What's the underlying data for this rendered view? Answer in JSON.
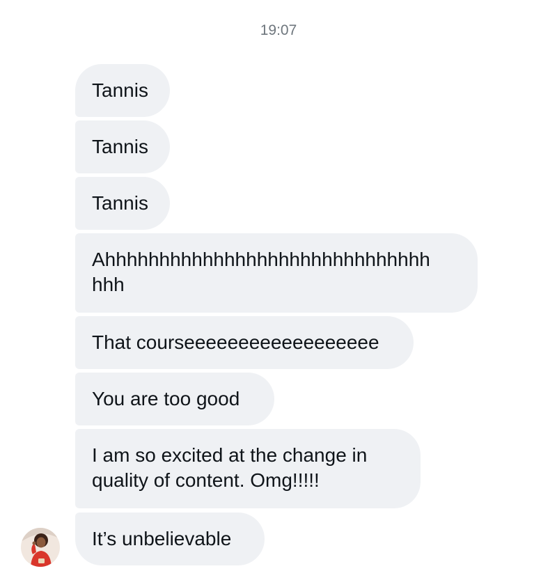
{
  "conversation": {
    "timestamp": "19:07",
    "messages": [
      {
        "text": "Tannis"
      },
      {
        "text": "Tannis"
      },
      {
        "text": "Tannis"
      },
      {
        "line1": "Ahhhhhhhhhhhhhhhhhhhhhhhhhhhhhh",
        "line2": "hhh"
      },
      {
        "text": "That courseeeeeeeeeeeeeeeeee"
      },
      {
        "text": "You are too good"
      },
      {
        "line1": "I am so excited at the change in",
        "line2": "quality of content. Omg!!!!!"
      },
      {
        "text": "It’s unbelievable"
      }
    ]
  },
  "colors": {
    "bubble_background": "#eff1f4",
    "timestamp_text": "#6e767d",
    "message_text": "#0f1419"
  },
  "avatar": {
    "icon": "user-photo-avatar"
  }
}
